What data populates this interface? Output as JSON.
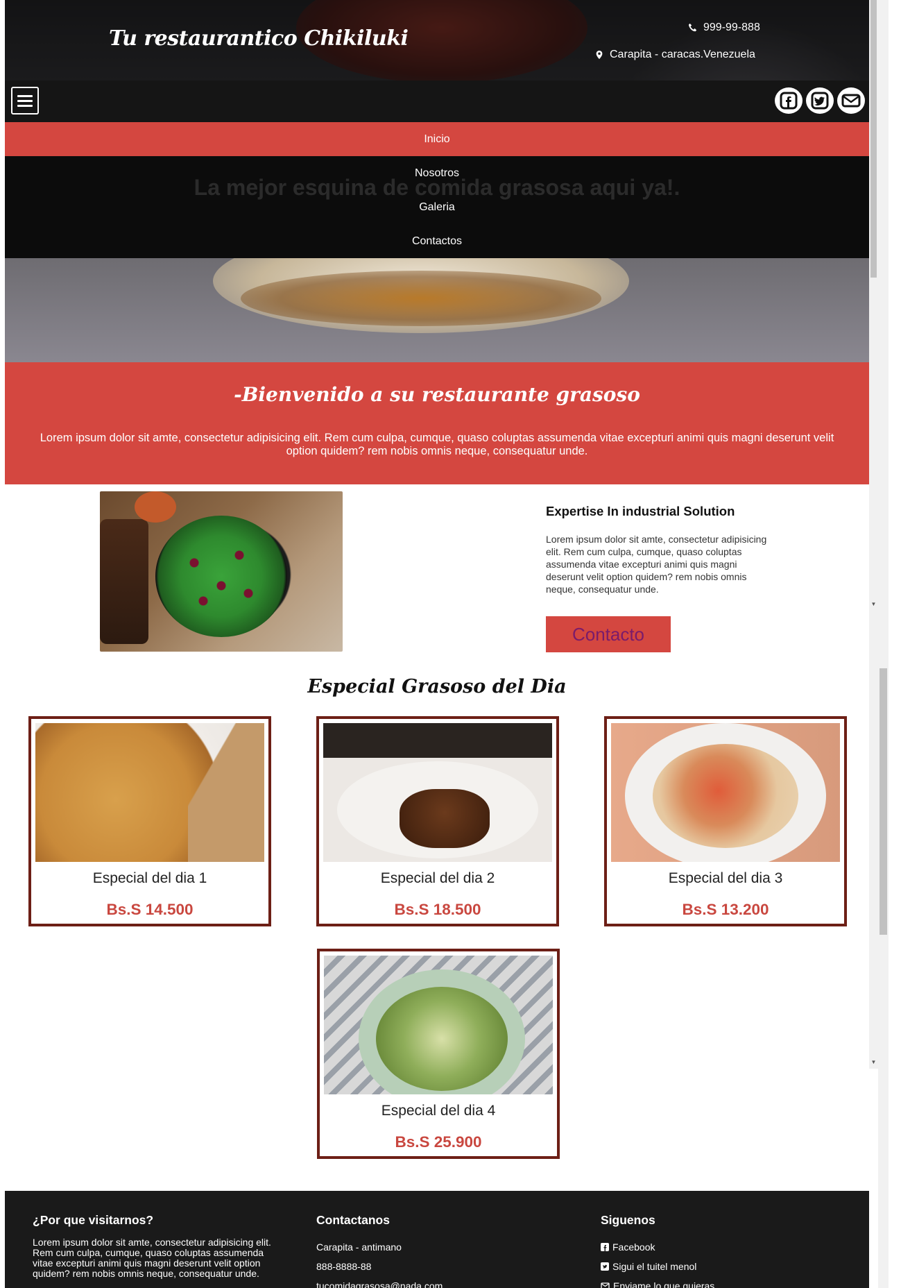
{
  "header": {
    "brand": "Tu restaurantico Chikiluki",
    "phone": "999-99-888",
    "location": "Carapita - caracas.Venezuela",
    "tagline": "La mejor esquina de comida grasosa aqui ya!."
  },
  "nav": {
    "menu_icon": "hamburger-icon",
    "items": [
      {
        "label": "Inicio",
        "active": true
      },
      {
        "label": "Nosotros",
        "active": false
      },
      {
        "label": "Galeria",
        "active": false
      },
      {
        "label": "Contactos",
        "active": false
      }
    ],
    "social_icons": [
      "facebook-icon",
      "twitter-icon",
      "envelope-icon"
    ]
  },
  "welcome": {
    "title": "-Bienvenido a su restaurante grasoso",
    "text": "Lorem ipsum dolor sit amte, consectetur adipisicing elit. Rem cum culpa, cumque, quaso coluptas assumenda vitae excepturi animi quis magni deserunt velit option quidem? rem nobis omnis neque, consequatur unde."
  },
  "expertise": {
    "title": "Expertise In industrial Solution",
    "text": "Lorem ipsum dolor sit amte, consectetur adipisicing elit. Rem cum culpa, cumque, quaso coluptas assumenda vitae excepturi animi quis magni deserunt velit option quidem? rem nobis omnis neque, consequatur unde.",
    "button": "Contacto"
  },
  "specials": {
    "title": "Especial Grasoso del Dia",
    "items": [
      {
        "name": "Especial del dia 1",
        "price": "Bs.S 14.500"
      },
      {
        "name": "Especial del dia 2",
        "price": "Bs.S 18.500"
      },
      {
        "name": "Especial del dia 3",
        "price": "Bs.S 13.200"
      },
      {
        "name": "Especial del dia 4",
        "price": "Bs.S 25.900"
      }
    ]
  },
  "footer": {
    "why": {
      "title": "¿Por que visitarnos?",
      "text": "Lorem ipsum dolor sit amte, consectetur adipisicing elit. Rem cum culpa, cumque, quaso coluptas assumenda vitae excepturi animi quis magni deserunt velit option quidem? rem nobis omnis neque, consequatur unde."
    },
    "contact": {
      "title": "Contactanos",
      "address": "Carapita - antimano",
      "phone": "888-8888-88",
      "email": "tucomidagrasosa@nada.com"
    },
    "follow": {
      "title": "Siguenos",
      "links": [
        "Facebook",
        "Sigui el tuitel menol",
        "Enviame lo que quieras"
      ]
    }
  },
  "colors": {
    "accent": "#d44740",
    "card_border": "#6d1f16",
    "price": "#c9473f",
    "footer_bg": "#1a1a1a"
  }
}
